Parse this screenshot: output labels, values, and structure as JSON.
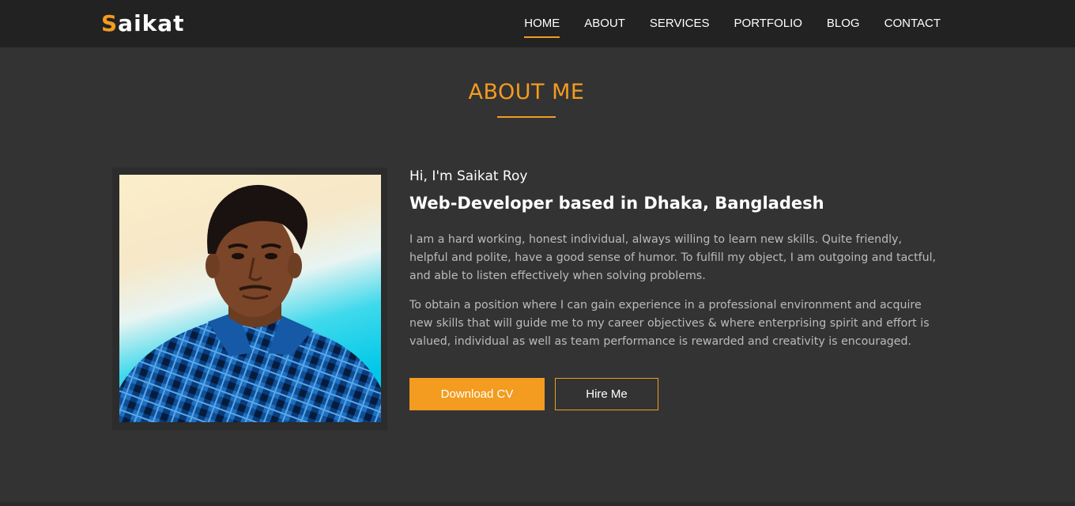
{
  "brand": {
    "first_letter": "S",
    "rest": "aikat",
    "accent_color": "#f39c1f"
  },
  "nav": {
    "items": [
      {
        "label": "HOME",
        "active": true
      },
      {
        "label": "ABOUT",
        "active": false
      },
      {
        "label": "SERVICES",
        "active": false
      },
      {
        "label": "PORTFOLIO",
        "active": false
      },
      {
        "label": "BLOG",
        "active": false
      },
      {
        "label": "CONTACT",
        "active": false
      }
    ]
  },
  "about": {
    "title": "ABOUT ME",
    "greeting": "Hi, I'm Saikat Roy",
    "headline": "Web-Developer based in Dhaka, Bangladesh",
    "paragraphs": [
      "I am a hard working, honest individual, always willing to learn new skills. Quite friendly, helpful and polite, have a good sense of humor. To fulfill my object, I am outgoing and tactful, and able to listen effectively when solving problems.",
      "To obtain a position where I can gain experience in a professional environment and acquire new skills that will guide me to my career objectives & where enterprising spirit and effort is valued, individual as well as team performance is rewarded and creativity is encouraged."
    ],
    "buttons": {
      "download": "Download CV",
      "hire": "Hire Me"
    }
  },
  "colors": {
    "background": "#333333",
    "navbar": "#222222",
    "accent": "#f39c1f",
    "body_text": "#bbbbbb"
  }
}
